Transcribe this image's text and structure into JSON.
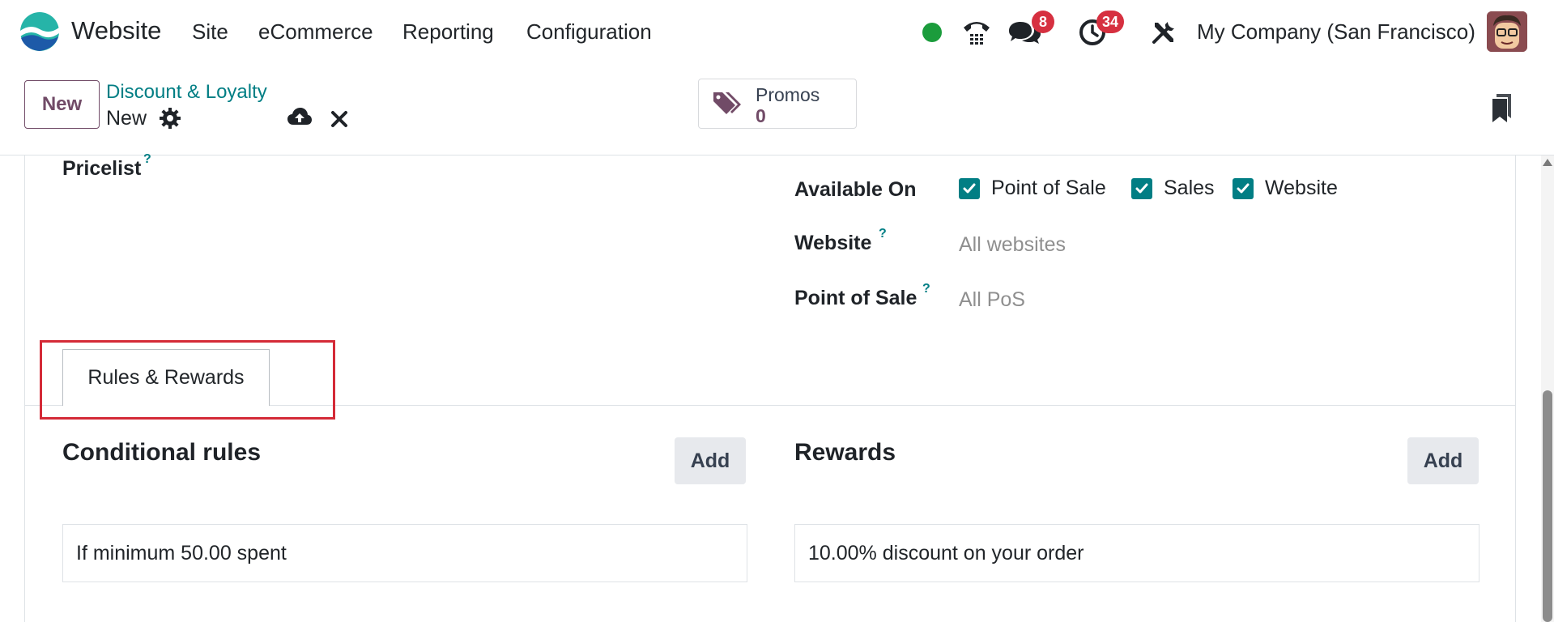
{
  "navbar": {
    "app_name": "Website",
    "menu": [
      "Site",
      "eCommerce",
      "Reporting",
      "Configuration"
    ],
    "messages_count": "8",
    "activities_count": "34",
    "company": "My Company (San Francisco)"
  },
  "control_panel": {
    "new_label": "New",
    "breadcrumb": "Discount & Loyalty",
    "record_name": "New",
    "stat_button": {
      "label": "Promos",
      "value": "0"
    }
  },
  "form": {
    "pricelist_label": "Pricelist",
    "available_on_label": "Available On",
    "available_on": [
      {
        "label": "Point of Sale",
        "checked": true
      },
      {
        "label": "Sales",
        "checked": true
      },
      {
        "label": "Website",
        "checked": true
      }
    ],
    "website_label": "Website",
    "website_value": "All websites",
    "pos_label": "Point of Sale",
    "pos_value": "All PoS",
    "help_mark": "?"
  },
  "tabs": [
    {
      "label": "Rules & Rewards",
      "active": true
    }
  ],
  "rules": {
    "title": "Conditional rules",
    "add_label": "Add",
    "items": [
      "If minimum 50.00 spent"
    ]
  },
  "rewards": {
    "title": "Rewards",
    "add_label": "Add",
    "items": [
      "10.00% discount on your order"
    ]
  },
  "colors": {
    "brand": "#714b67",
    "accent": "#017e84",
    "badge": "#d63040",
    "online": "#1b9c3c",
    "highlight": "#d42a37"
  },
  "icons": [
    "app-logo-icon",
    "phone-icon",
    "chat-icon",
    "clock-icon",
    "tools-icon",
    "gear-icon",
    "cloud-upload-icon",
    "close-icon",
    "tags-icon",
    "bookmark-icon",
    "check-icon"
  ]
}
